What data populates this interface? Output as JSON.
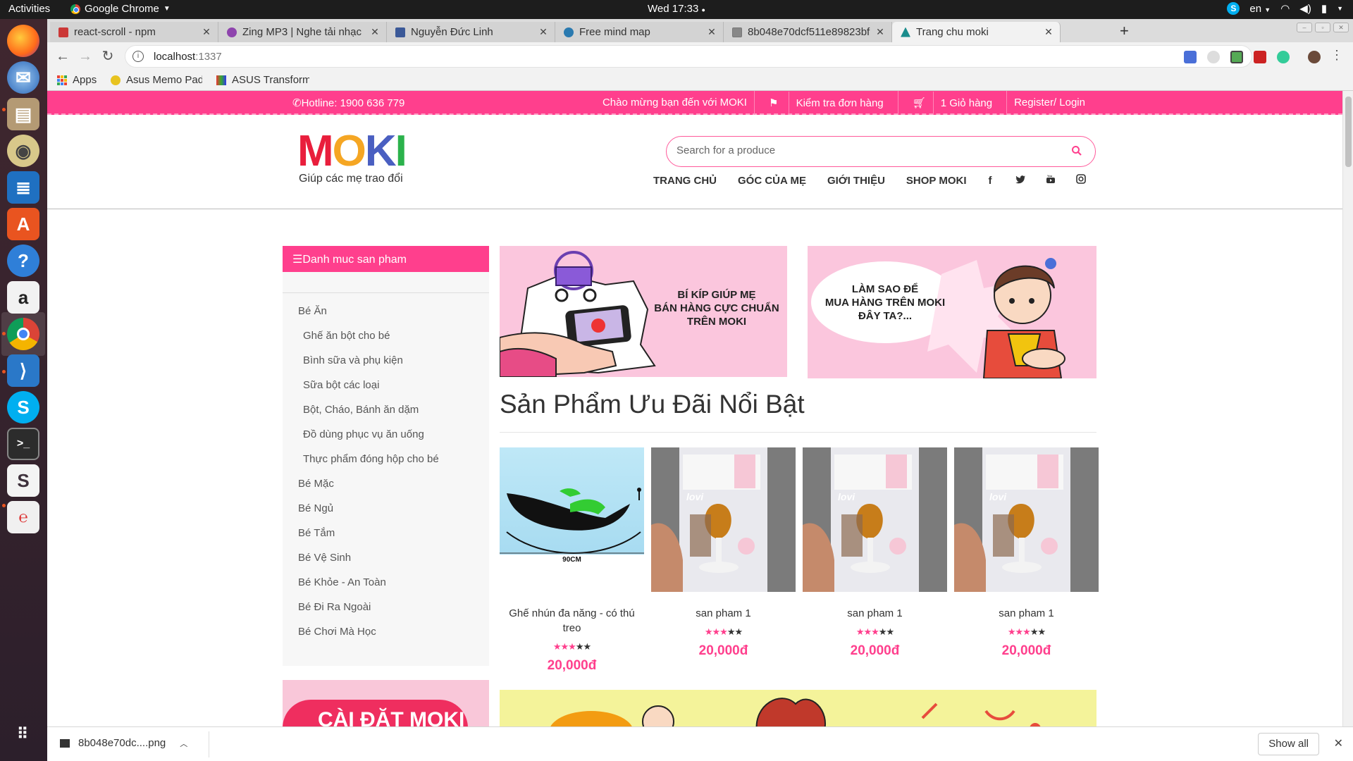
{
  "os": {
    "activities": "Activities",
    "app_name": "Google Chrome",
    "clock": "Wed 17:33",
    "language": "en"
  },
  "browser": {
    "tabs": [
      {
        "label": "react-scroll - npm",
        "favicon_color": "#cb3837"
      },
      {
        "label": "Zing MP3 | Nghe tải nhạc",
        "favicon_color": "#8e44ad"
      },
      {
        "label": "Nguyễn Đức Linh",
        "favicon_color": "#3b5998"
      },
      {
        "label": "Free mind map",
        "favicon_color": "#2a7ab0"
      },
      {
        "label": "8b048e70dcf511e89823bf",
        "favicon_color": "#888888"
      },
      {
        "label": "Trang chu moki",
        "favicon_color": "#1a8c8c"
      }
    ],
    "active_tab": 5,
    "url_host": "localhost",
    "url_port": ":1337",
    "bookmarks": [
      "Apps",
      "Asus Memo Pad",
      "ASUS Transform"
    ]
  },
  "site": {
    "hotline": "Hotline: 1900 636 779",
    "welcome": "Chào mừng bạn đến với MOKI",
    "check_order": "Kiểm tra đơn hàng",
    "cart": "1 Giỏ hàng",
    "register_login": "Register/ Login",
    "logo_letters": [
      "M",
      "O",
      "K",
      "I"
    ],
    "logo_colors": [
      "#e91e3c",
      "#f5a623",
      "#4a5fc1",
      "#2bb24c"
    ],
    "tagline": "Giúp các mẹ trao đổi",
    "search_placeholder": "Search for a produce",
    "nav": [
      "TRANG CHỦ",
      "GÓC CỦA MẸ",
      "GIỚI THIỆU",
      "SHOP MOKI"
    ],
    "social_icons": [
      "facebook-icon",
      "twitter-icon",
      "youtube-icon",
      "instagram-icon"
    ],
    "accent": "#ff3f8d"
  },
  "sidebar": {
    "title": "Danh muc san pham",
    "categories": [
      {
        "label": "Bé Ăn",
        "sub": false
      },
      {
        "label": "Ghế ăn bột cho bé",
        "sub": true
      },
      {
        "label": "Bình sữa và phụ kiện",
        "sub": true
      },
      {
        "label": "Sữa bột các loại",
        "sub": true
      },
      {
        "label": "Bột, Cháo, Bánh ăn dặm",
        "sub": true
      },
      {
        "label": "Đồ dùng phục vụ ăn uống",
        "sub": true
      },
      {
        "label": "Thực phẩm đóng hộp cho bé",
        "sub": true
      },
      {
        "label": "Bé Mặc",
        "sub": false
      },
      {
        "label": "Bé Ngủ",
        "sub": false
      },
      {
        "label": "Bé Tắm",
        "sub": false
      },
      {
        "label": "Bé Vệ Sinh",
        "sub": false
      },
      {
        "label": "Bé Khỏe - An Toàn",
        "sub": false
      },
      {
        "label": "Bé Đi Ra Ngoài",
        "sub": false
      },
      {
        "label": "Bé Chơi Mà Học",
        "sub": false
      }
    ],
    "install_banner": "CÀI ĐẶT MOKI"
  },
  "banners": [
    {
      "text_lines": [
        "BÍ KÍP GIÚP MẸ",
        "BÁN HÀNG CỰC CHUẨN",
        "TRÊN MOKI"
      ]
    },
    {
      "text_lines": [
        "LÀM SAO ĐỂ",
        "MUA HÀNG TRÊN MOKI",
        "ĐÂY TA?..."
      ]
    }
  ],
  "featured": {
    "title": "Sản Phẩm Ưu Đãi Nổi Bật",
    "products": [
      {
        "name": "Ghế nhún đa năng - có thú treo",
        "rating": 3,
        "max_rating": 5,
        "price": "20,000đ",
        "image_label": "90CM"
      },
      {
        "name": "san pham 1",
        "rating": 3,
        "max_rating": 5,
        "price": "20,000đ",
        "image_label": "lovi"
      },
      {
        "name": "san pham 1",
        "rating": 3,
        "max_rating": 5,
        "price": "20,000đ",
        "image_label": "lovi"
      },
      {
        "name": "san pham 1",
        "rating": 3,
        "max_rating": 5,
        "price": "20,000đ",
        "image_label": "lovi"
      }
    ]
  },
  "downloads": {
    "file": "8b048e70dc....png",
    "show_all": "Show all"
  }
}
